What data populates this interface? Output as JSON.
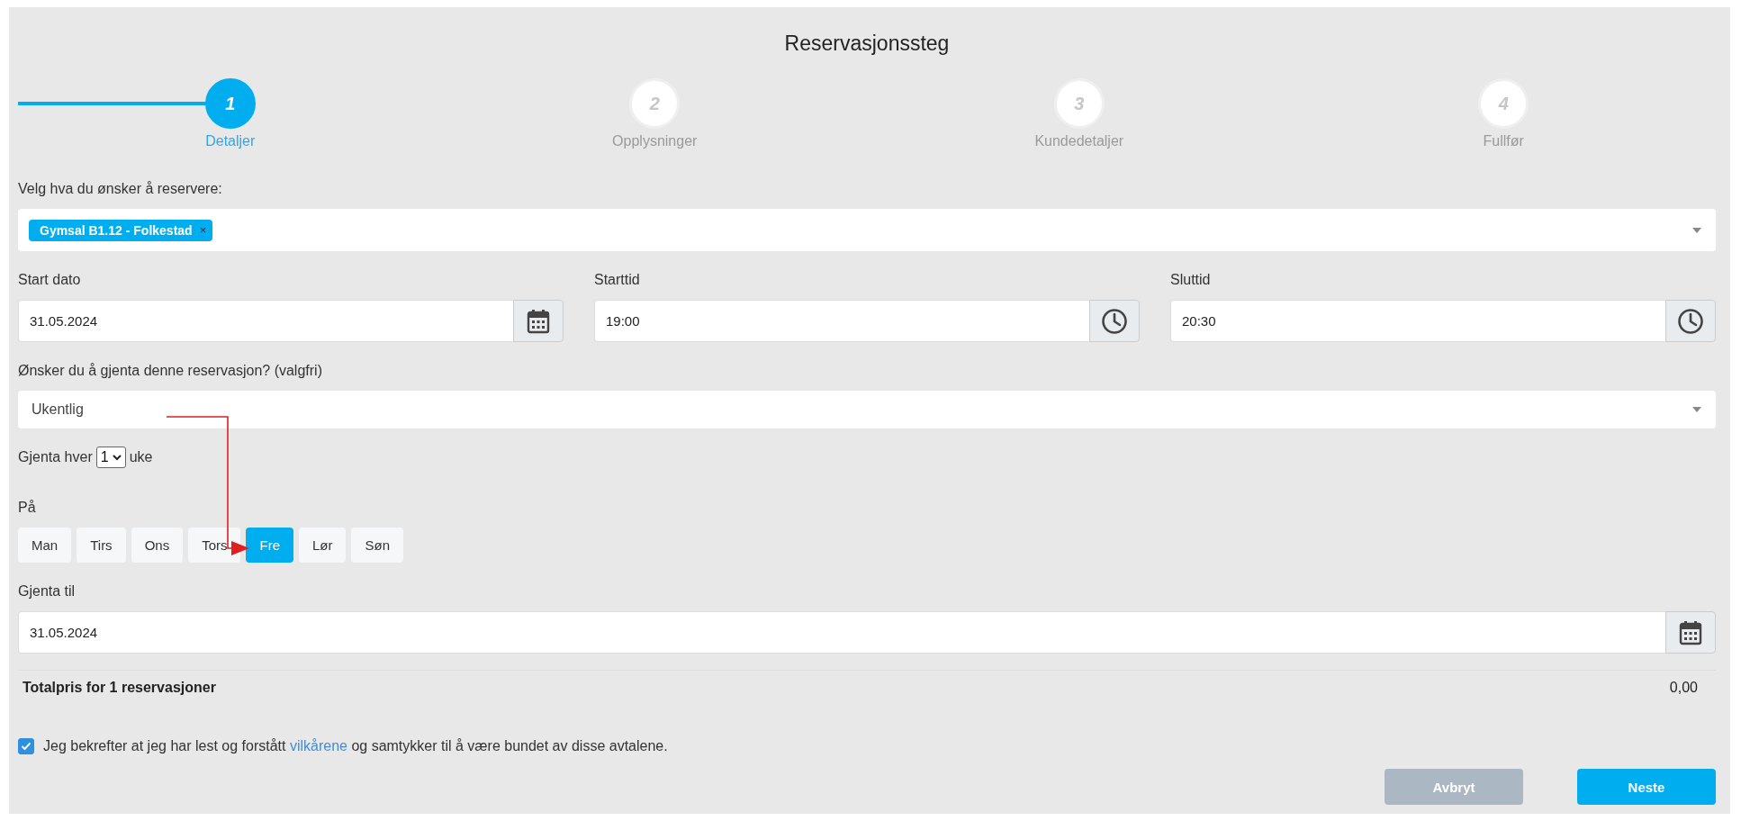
{
  "title": "Reservasjonssteg",
  "steps": [
    {
      "number": "1",
      "label": "Detaljer",
      "selected": true
    },
    {
      "number": "2",
      "label": "Opplysninger",
      "selected": false
    },
    {
      "number": "3",
      "label": "Kundedetaljer",
      "selected": false
    },
    {
      "number": "4",
      "label": "Fullfør",
      "selected": false
    }
  ],
  "resource": {
    "label": "Velg hva du ønsker å reservere:",
    "tags": [
      {
        "text": "Gymsal B1.12 - Folkestad",
        "remove": "×"
      }
    ]
  },
  "times": [
    {
      "label": "Start dato",
      "value": "31.05.2024",
      "kind": "date"
    },
    {
      "label": "Starttid",
      "value": "19:00",
      "kind": "time"
    },
    {
      "label": "Sluttid",
      "value": "20:30",
      "kind": "time"
    }
  ],
  "repeat": {
    "label": "Ønsker du å gjenta denne reservasjon? (valgfri)",
    "value": "Ukentlig"
  },
  "interval": {
    "before": "Gjenta hver",
    "value": "1",
    "after": "uke"
  },
  "days": {
    "label": "På",
    "items": [
      {
        "label": "Man",
        "selected": false
      },
      {
        "label": "Tirs",
        "selected": false
      },
      {
        "label": "Ons",
        "selected": false
      },
      {
        "label": "Tors",
        "selected": false
      },
      {
        "label": "Fre",
        "selected": true
      },
      {
        "label": "Lør",
        "selected": false
      },
      {
        "label": "Søn",
        "selected": false
      }
    ]
  },
  "until": {
    "label": "Gjenta til",
    "value": "31.05.2024",
    "kind": "date"
  },
  "total": {
    "label": "Totalpris for 1 reservasjoner",
    "value": "0,00"
  },
  "terms": {
    "checked": true,
    "text_before": "Jeg bekrefter at jeg har lest og forstått",
    "link": "vilkårene",
    "text_after": "og samtykker til å være bundet av disse avtalene."
  },
  "buttons": [
    {
      "label": "Avbryt",
      "kind": "secondary"
    },
    {
      "label": "Neste",
      "kind": "primary"
    }
  ]
}
